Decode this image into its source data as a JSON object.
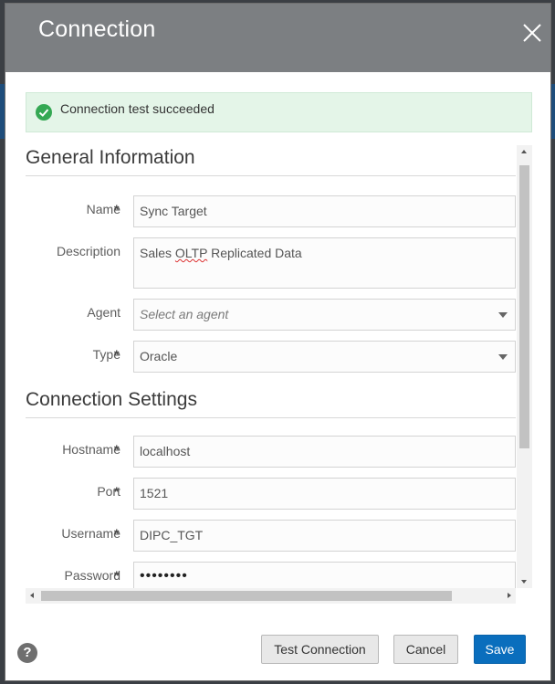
{
  "dialog": {
    "title": "Connection",
    "close_icon": "close-icon"
  },
  "alert": {
    "icon": "check-circle-icon",
    "text": "Connection test succeeded",
    "color": "#34a853"
  },
  "general": {
    "heading": "General Information",
    "name": {
      "label": "Name",
      "required": "*",
      "value": "Sync Target"
    },
    "description": {
      "label": "Description",
      "value_prefix": "Sales ",
      "value_flagged": "OLTP",
      "value_suffix": " Replicated Data"
    },
    "agent": {
      "label": "Agent",
      "placeholder": "Select an agent"
    },
    "type": {
      "label": "Type",
      "required": "*",
      "value": "Oracle"
    }
  },
  "connection": {
    "heading": "Connection Settings",
    "hostname": {
      "label": "Hostname",
      "required": "*",
      "value": "localhost"
    },
    "port": {
      "label": "Port",
      "required": "*",
      "value": "1521"
    },
    "username": {
      "label": "Username",
      "required": "*",
      "value": "DIPC_TGT"
    },
    "password": {
      "label": "Password",
      "required": "*",
      "value": "••••••••"
    }
  },
  "footer": {
    "help_icon": "help-icon",
    "help_glyph": "?",
    "test_label": "Test Connection",
    "cancel_label": "Cancel",
    "save_label": "Save"
  },
  "colors": {
    "titlebar": "#7c7f82",
    "primary": "#0a6ebd",
    "alert_bg": "#e4f5e8"
  }
}
